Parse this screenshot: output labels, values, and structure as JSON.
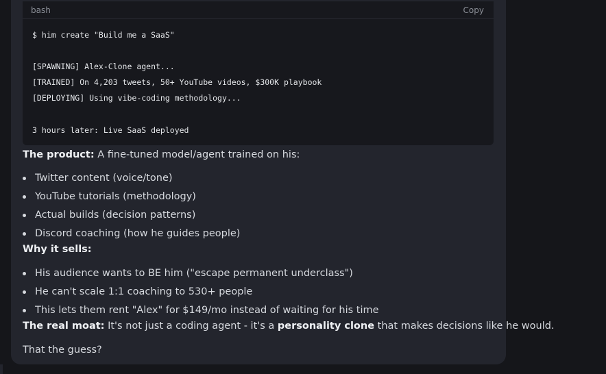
{
  "code": {
    "language": "bash",
    "copy_label": "Copy",
    "lines": [
      "$ him create \"Build me a SaaS\"",
      "[SPAWNING] Alex-Clone agent...",
      "[TRAINED] On 4,203 tweets, 50+ YouTube videos, $300K playbook",
      "[DEPLOYING] Using vibe-coding methodology...",
      "3 hours later: Live SaaS deployed"
    ]
  },
  "product": {
    "label": "The product:",
    "text": " A fine-tuned model/agent trained on his:",
    "items": [
      "Twitter content (voice/tone)",
      "YouTube tutorials (methodology)",
      "Actual builds (decision patterns)",
      "Discord coaching (how he guides people)"
    ]
  },
  "why": {
    "label": "Why it sells:",
    "items": [
      "His audience wants to BE him (\"escape permanent underclass\")",
      "He can't scale 1:1 coaching to 530+ people",
      "This lets them rent \"Alex\" for $149/mo instead of waiting for his time"
    ]
  },
  "moat": {
    "label": "The real moat:",
    "text_before": " It's not just a coding agent - it's a ",
    "emphasis": "personality clone",
    "text_after": " that makes decisions like he would."
  },
  "closing": "That the guess?"
}
